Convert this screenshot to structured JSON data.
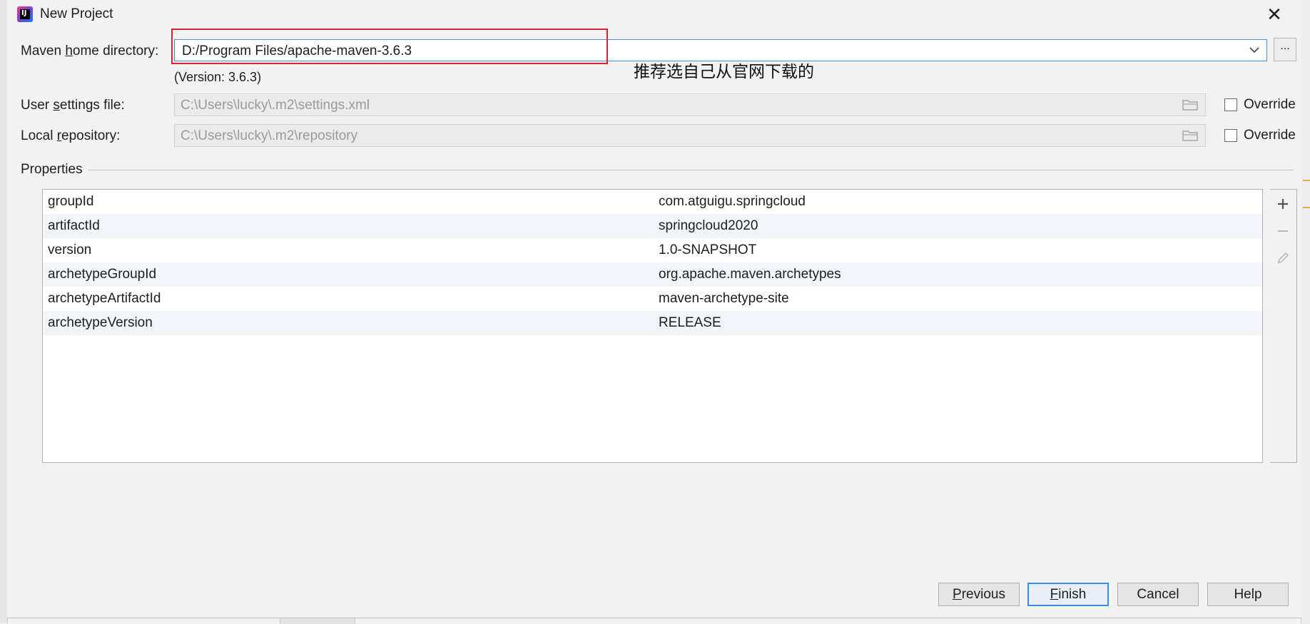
{
  "window": {
    "title": "New Project",
    "app_icon": "intellij-idea-icon",
    "close_icon": "close-icon"
  },
  "maven": {
    "home_label_pre": "Maven ",
    "home_label_mnemonic": "h",
    "home_label_post": "ome directory:",
    "home_value": "D:/Program Files/apache-maven-3.6.3",
    "browse_label": "...",
    "version_text": "(Version: 3.6.3)",
    "annotation": "推荐选自己从官网下载的",
    "highlight_color": "#d9232d"
  },
  "settings": {
    "user_label_pre": "User ",
    "user_label_mnemonic": "s",
    "user_label_post": "ettings file:",
    "user_value": "C:\\Users\\lucky\\.m2\\settings.xml",
    "repo_label_pre": "Local ",
    "repo_label_mnemonic": "r",
    "repo_label_post": "epository:",
    "repo_value": "C:\\Users\\lucky\\.m2\\repository",
    "override_label": "Override"
  },
  "properties": {
    "section_title": "Properties",
    "rows": [
      {
        "key": "groupId",
        "value": "com.atguigu.springcloud"
      },
      {
        "key": "artifactId",
        "value": "springcloud2020"
      },
      {
        "key": "version",
        "value": "1.0-SNAPSHOT"
      },
      {
        "key": "archetypeGroupId",
        "value": "org.apache.maven.archetypes"
      },
      {
        "key": "archetypeArtifactId",
        "value": "maven-archetype-site"
      },
      {
        "key": "archetypeVersion",
        "value": "RELEASE"
      }
    ],
    "tools": [
      "plus-icon",
      "minus-icon",
      "edit-icon"
    ]
  },
  "buttons": {
    "previous_mnemonic": "P",
    "previous_rest": "revious",
    "finish_mnemonic": "F",
    "finish_rest": "inish",
    "cancel": "Cancel",
    "help": "Help"
  },
  "colors": {
    "accent": "#3a8ee6",
    "dialog_bg": "#f2f2f2",
    "disabled_text": "#9a9a9a"
  }
}
